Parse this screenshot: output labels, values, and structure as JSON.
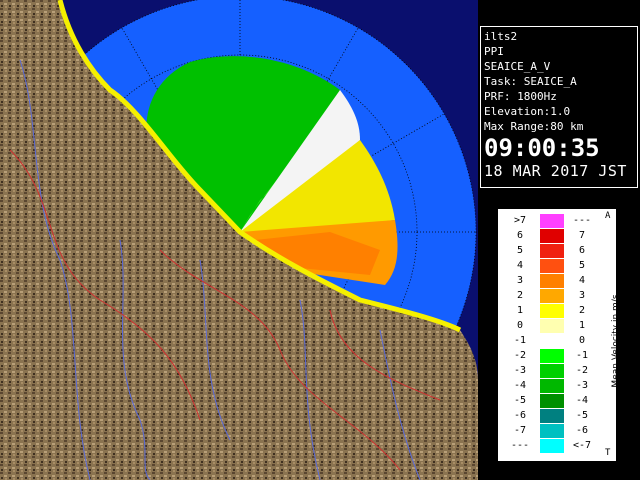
{
  "info": {
    "radar_name": "ilts2",
    "scan_type": "PPI",
    "product": "SEAICE_A_V",
    "task": "Task: SEAICE_A",
    "prf": "PRF: 1800Hz",
    "elevation": "Elevation:1.0",
    "max_range": "Max Range:80 km",
    "time": "09:00:35",
    "date": "18 MAR 2017 JST"
  },
  "legend": {
    "title": "Mean Velocity in m/s",
    "corner_top": "A",
    "corner_bottom": "T",
    "rows": [
      {
        "left": ">7",
        "right": "---",
        "color": "#ff40ff"
      },
      {
        "left": "6",
        "right": "7",
        "color": "#e00000"
      },
      {
        "left": "5",
        "right": "6",
        "color": "#f02010"
      },
      {
        "left": "4",
        "right": "5",
        "color": "#ff5010"
      },
      {
        "left": "3",
        "right": "4",
        "color": "#ff8000"
      },
      {
        "left": "2",
        "right": "3",
        "color": "#ffa800"
      },
      {
        "left": "1",
        "right": "2",
        "color": "#ffff00"
      },
      {
        "left": "0",
        "right": "1",
        "color": "#ffffb0"
      },
      {
        "left": "-1",
        "right": "0",
        "color": "#ffffff"
      },
      {
        "left": "-2",
        "right": "-1",
        "color": "#00ff00"
      },
      {
        "left": "-3",
        "right": "-2",
        "color": "#00d000"
      },
      {
        "left": "-4",
        "right": "-3",
        "color": "#00b800"
      },
      {
        "left": "-5",
        "right": "-4",
        "color": "#009000"
      },
      {
        "left": "-6",
        "right": "-5",
        "color": "#008080"
      },
      {
        "left": "-7",
        "right": "-6",
        "color": "#00c0c0"
      },
      {
        "left": "---",
        "right": "<-7",
        "color": "#00ffff"
      }
    ]
  },
  "colors": {
    "coverage": "#1560ff",
    "land": "#8a7350",
    "ocean_outer": "#0a0f6e"
  }
}
